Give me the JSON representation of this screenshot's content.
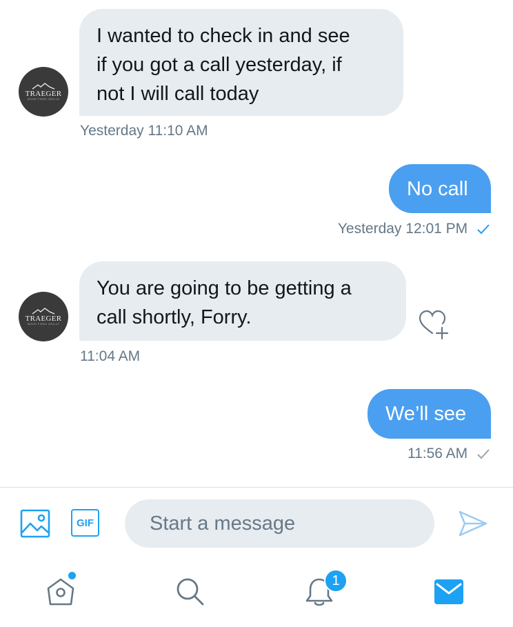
{
  "thread": {
    "contact": {
      "avatar_brand": "TRAEGER",
      "avatar_tagline": "WOOD FIRED GRILLS"
    },
    "messages": [
      {
        "direction": "incoming",
        "lines": [
          "I wanted to check in and see",
          "if you got a call yesterday, if",
          "not I will call today"
        ],
        "timestamp": "Yesterday 11:10 AM"
      },
      {
        "direction": "outgoing",
        "lines": [
          "No call"
        ],
        "timestamp": "Yesterday 12:01 PM",
        "status": "read",
        "status_icon": "check-icon",
        "status_color": "#1da1f2"
      },
      {
        "direction": "incoming",
        "lines": [
          "You are going to be getting a",
          "call shortly, Forry."
        ],
        "timestamp": "11:04 AM",
        "action_icon": "like-add-icon"
      },
      {
        "direction": "outgoing",
        "lines": [
          "We’ll see"
        ],
        "timestamp": "11:56 AM",
        "status": "sent",
        "status_icon": "check-icon",
        "status_color": "#9aa5ae"
      }
    ]
  },
  "composer": {
    "media_icon": "image-icon",
    "gif_label": "GIF",
    "placeholder": "Start a message",
    "send_icon": "send-icon"
  },
  "tabbar": {
    "tabs": [
      {
        "name": "home",
        "icon": "home-icon",
        "has_dot": true
      },
      {
        "name": "search",
        "icon": "search-icon"
      },
      {
        "name": "notifications",
        "icon": "bell-icon",
        "badge": "1"
      },
      {
        "name": "messages",
        "icon": "mail-icon",
        "active": true
      }
    ]
  },
  "colors": {
    "accent": "#1da1f2",
    "outgoing_bubble": "#4a9ff0",
    "incoming_bubble": "#e6ecf0",
    "meta_text": "#657786"
  }
}
